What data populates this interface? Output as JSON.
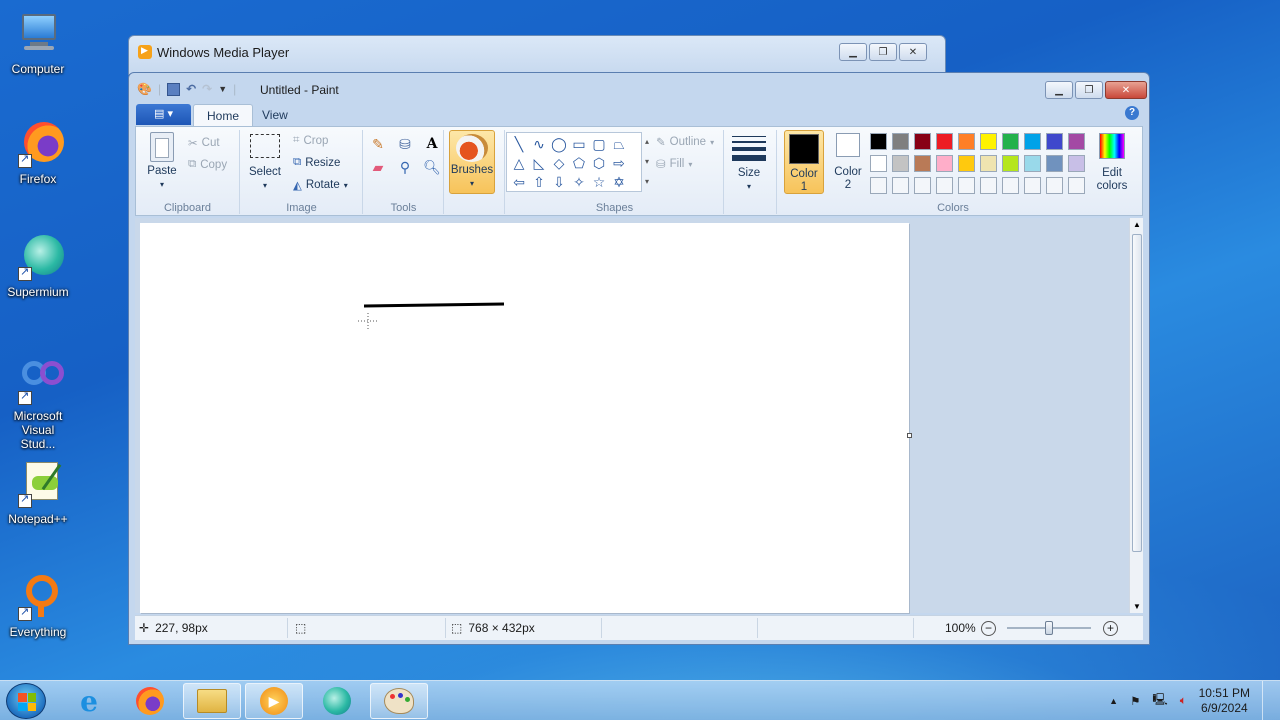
{
  "desktop": {
    "icons": [
      {
        "label": "Computer"
      },
      {
        "label": "Firefox"
      },
      {
        "label": "Supermium"
      },
      {
        "label": "Microsoft Visual Stud..."
      },
      {
        "label": "Notepad++"
      },
      {
        "label": "Everything"
      }
    ]
  },
  "background_window": {
    "title": "Windows Media Player"
  },
  "paint": {
    "title": "Untitled - Paint",
    "tabs": [
      "Home",
      "View"
    ],
    "clipboard": {
      "paste": "Paste",
      "cut": "Cut",
      "copy": "Copy",
      "label": "Clipboard"
    },
    "image": {
      "select": "Select",
      "crop": "Crop",
      "resize": "Resize",
      "rotate": "Rotate",
      "label": "Image"
    },
    "tools": {
      "label": "Tools",
      "text_glyph": "A"
    },
    "brushes": {
      "label": "Brushes"
    },
    "shapes": {
      "outline": "Outline",
      "fill": "Fill",
      "label": "Shapes"
    },
    "size": {
      "label": "Size"
    },
    "colors": {
      "color1_label": "Color",
      "color1_num": "1",
      "color2_label": "Color",
      "color2_num": "2",
      "edit_label": "Edit",
      "edit_label2": "colors",
      "label": "Colors",
      "color1": "#000000",
      "color2": "#ffffff",
      "palette_row1": [
        "#000000",
        "#7f7f7f",
        "#880015",
        "#ed1c24",
        "#ff7f27",
        "#fff200",
        "#22b14c",
        "#00a2e8",
        "#3f48cc",
        "#a349a4"
      ],
      "palette_row2": [
        "#ffffff",
        "#c3c3c3",
        "#b97a57",
        "#ffaec9",
        "#ffc90e",
        "#efe4b0",
        "#b5e61d",
        "#99d9ea",
        "#7092be",
        "#c8bfe7"
      ]
    },
    "status": {
      "cursor_pos": "227, 98px",
      "image_size": "768 × 432px",
      "zoom": "100%"
    }
  },
  "taskbar": {
    "time": "10:51 PM",
    "date": "6/9/2024"
  }
}
